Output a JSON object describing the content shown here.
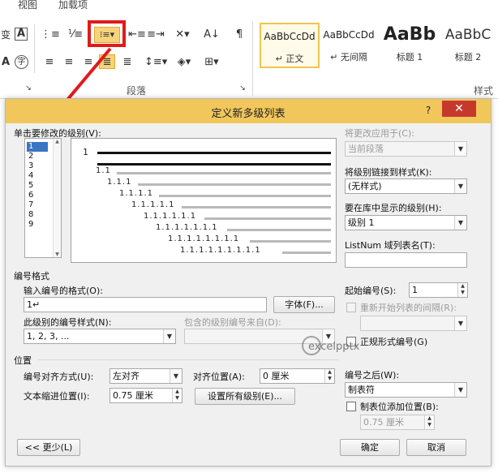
{
  "ribbon": {
    "tabs": [
      "视图",
      "加载项"
    ],
    "group_paragraph": "段落",
    "group_styles": "样式",
    "styles": [
      {
        "sample": "AaBbCcDd",
        "name": "↵ 正文"
      },
      {
        "sample": "AaBbCcDd",
        "name": "↵ 无间隔"
      },
      {
        "sample": "AaBb",
        "name": "标题 1"
      },
      {
        "sample": "AaBbC",
        "name": "标题 2"
      }
    ],
    "icons": {
      "change_case": "变",
      "char_border": "A",
      "phonetic": "A",
      "enclose": "字"
    }
  },
  "dialog": {
    "title": "定义新多级列表",
    "help": "?",
    "close": "✕",
    "click_level_label": "单击要修改的级别(V):",
    "levels": [
      "1",
      "2",
      "3",
      "4",
      "5",
      "6",
      "7",
      "8",
      "9"
    ],
    "selected_level": "1",
    "preview": {
      "items": [
        "1",
        "1.1",
        "1.1.1",
        "1.1.1.1",
        "1.1.1.1.1",
        "1.1.1.1.1.1",
        "1.1.1.1.1.1.1",
        "1.1.1.1.1.1.1.1",
        "1.1.1.1.1.1.1.1.1"
      ]
    },
    "apply_to": {
      "label": "将更改应用于(C):",
      "value": "当前段落"
    },
    "link_style": {
      "label": "将级别链接到样式(K):",
      "value": "(无样式)"
    },
    "gallery_level": {
      "label": "要在库中显示的级别(H):",
      "value": "级别 1"
    },
    "listnum": {
      "label": "ListNum 域列表名(T):",
      "value": ""
    },
    "number_format_section": "编号格式",
    "enter_format": {
      "label": "输入编号的格式(O):",
      "value": "1↵"
    },
    "font_button": "字体(F)...",
    "number_style": {
      "label": "此级别的编号样式(N):",
      "value": "1, 2, 3, ..."
    },
    "include_level": {
      "label": "包含的级别编号来自(D):",
      "value": ""
    },
    "start_at": {
      "label": "起始编号(S):",
      "value": "1"
    },
    "restart_after": {
      "label": "重新开始列表的间隔(R):",
      "value": ""
    },
    "legal_style": "正规形式编号(G)",
    "position_section": "位置",
    "alignment": {
      "label": "编号对齐方式(U):",
      "value": "左对齐"
    },
    "aligned_at": {
      "label": "对齐位置(A):",
      "value": "0 厘米"
    },
    "text_indent": {
      "label": "文本缩进位置(I):",
      "value": "0.75 厘米"
    },
    "set_all_levels": "设置所有级别(E)...",
    "follow_number": {
      "label": "编号之后(W):",
      "value": "制表符"
    },
    "tab_stop": {
      "label": "制表位添加位置(B):",
      "value": "0.75 厘米"
    },
    "less_button": "<< 更少(L)",
    "ok_button": "确定",
    "cancel_button": "取消"
  },
  "watermark": "excelpptx",
  "colors": {
    "title_bar": "#f1c75c",
    "close": "#c7382c",
    "highlight": "#e01b1b",
    "selected_level": "#3a75c4"
  }
}
